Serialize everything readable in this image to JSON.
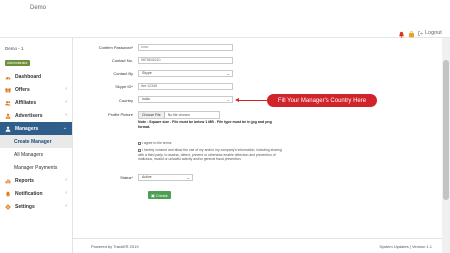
{
  "app": {
    "brand": "Demo",
    "logout_label": "Logout"
  },
  "user": {
    "name": "Demo - 1",
    "role_badge": "Administrator"
  },
  "sidebar": {
    "items": [
      {
        "label": "Dashboard",
        "icon": "dashboard-icon",
        "has_chevron": false
      },
      {
        "label": "Offers",
        "icon": "gift-icon",
        "has_chevron": true
      },
      {
        "label": "Affiliates",
        "icon": "users-icon",
        "has_chevron": true
      },
      {
        "label": "Advertisers",
        "icon": "user-tie-icon",
        "has_chevron": true
      },
      {
        "label": "Managers",
        "icon": "manager-icon",
        "has_chevron": true,
        "active": true
      }
    ],
    "sub_items": [
      {
        "label": "Create Manager",
        "active": true
      },
      {
        "label": "All Managers"
      },
      {
        "label": "Manager Payments"
      }
    ],
    "items_bottom": [
      {
        "label": "Reports",
        "icon": "chart-icon",
        "has_chevron": true
      },
      {
        "label": "Notification",
        "icon": "bell-icon",
        "has_chevron": true
      },
      {
        "label": "Settings",
        "icon": "gear-icon",
        "has_chevron": true
      }
    ]
  },
  "form": {
    "confirm_password": {
      "label": "Confirm Password*",
      "value": "••••••"
    },
    "contact_no": {
      "label": "Contact No.",
      "value": "9876543210"
    },
    "contact_by": {
      "label": "Contact By",
      "value": "Skype"
    },
    "skype_id": {
      "label": "Skype ID*",
      "value": "live:12345"
    },
    "country": {
      "label": "Country",
      "value": "India"
    },
    "profile_picture": {
      "label": "Profile Picture",
      "button": "Choose File",
      "file_text": "No file chosen",
      "note": "Note : Square size . File must be below 1 MB . File type must be in jpg and png format."
    },
    "agree_terms": "I agree to the terms",
    "consent": "I hereby consent and allow the use of my and/or my company's information, including sharing with a third party, to assess, detect, prevent or otherwise enable detection and prevention of malicious, invalid or unlawful activity and/or general fraud prevention.",
    "status": {
      "label": "Status*",
      "value": "Active"
    },
    "create_button": "Create"
  },
  "callout": {
    "text": "Fill Your Manager's Country Here",
    "color": "#d1232a"
  },
  "footer": {
    "left": "Powered by TrackER 2019",
    "right": "System Updates | Version 1.1"
  }
}
